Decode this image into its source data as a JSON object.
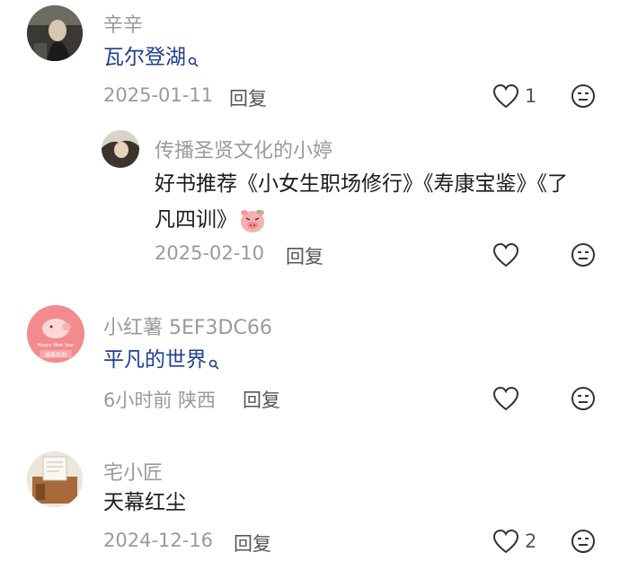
{
  "comments": [
    {
      "username": "辛辛",
      "content": "瓦尔登湖",
      "date": "2025-01-11",
      "reply_label": "回复",
      "like_count": "1"
    },
    {
      "username": "传播圣贤文化的小婷",
      "content_line1": "好书推荐《小女生职场修行》《寿康宝鉴》《了",
      "content_line2": "凡四训》",
      "date": "2025-02-10",
      "reply_label": "回复"
    },
    {
      "username": "小红薯 5EF3DC66",
      "content": "平凡的世界",
      "time": "6小时前",
      "location": "陕西",
      "reply_label": "回复",
      "avatar_text_top": "Happy New Year",
      "avatar_text_bottom": "福事将到"
    },
    {
      "username": "宅小匠",
      "content": "天幕红尘",
      "date": "2024-12-16",
      "reply_label": "回复",
      "like_count": "2"
    }
  ],
  "colors": {
    "link": "#1f3f8f",
    "meta": "#9a9a9a",
    "text": "#1b1b1b"
  },
  "icons": [
    "heart-icon",
    "dislike-face-icon",
    "search-mark-icon",
    "pig-sticker-icon"
  ]
}
